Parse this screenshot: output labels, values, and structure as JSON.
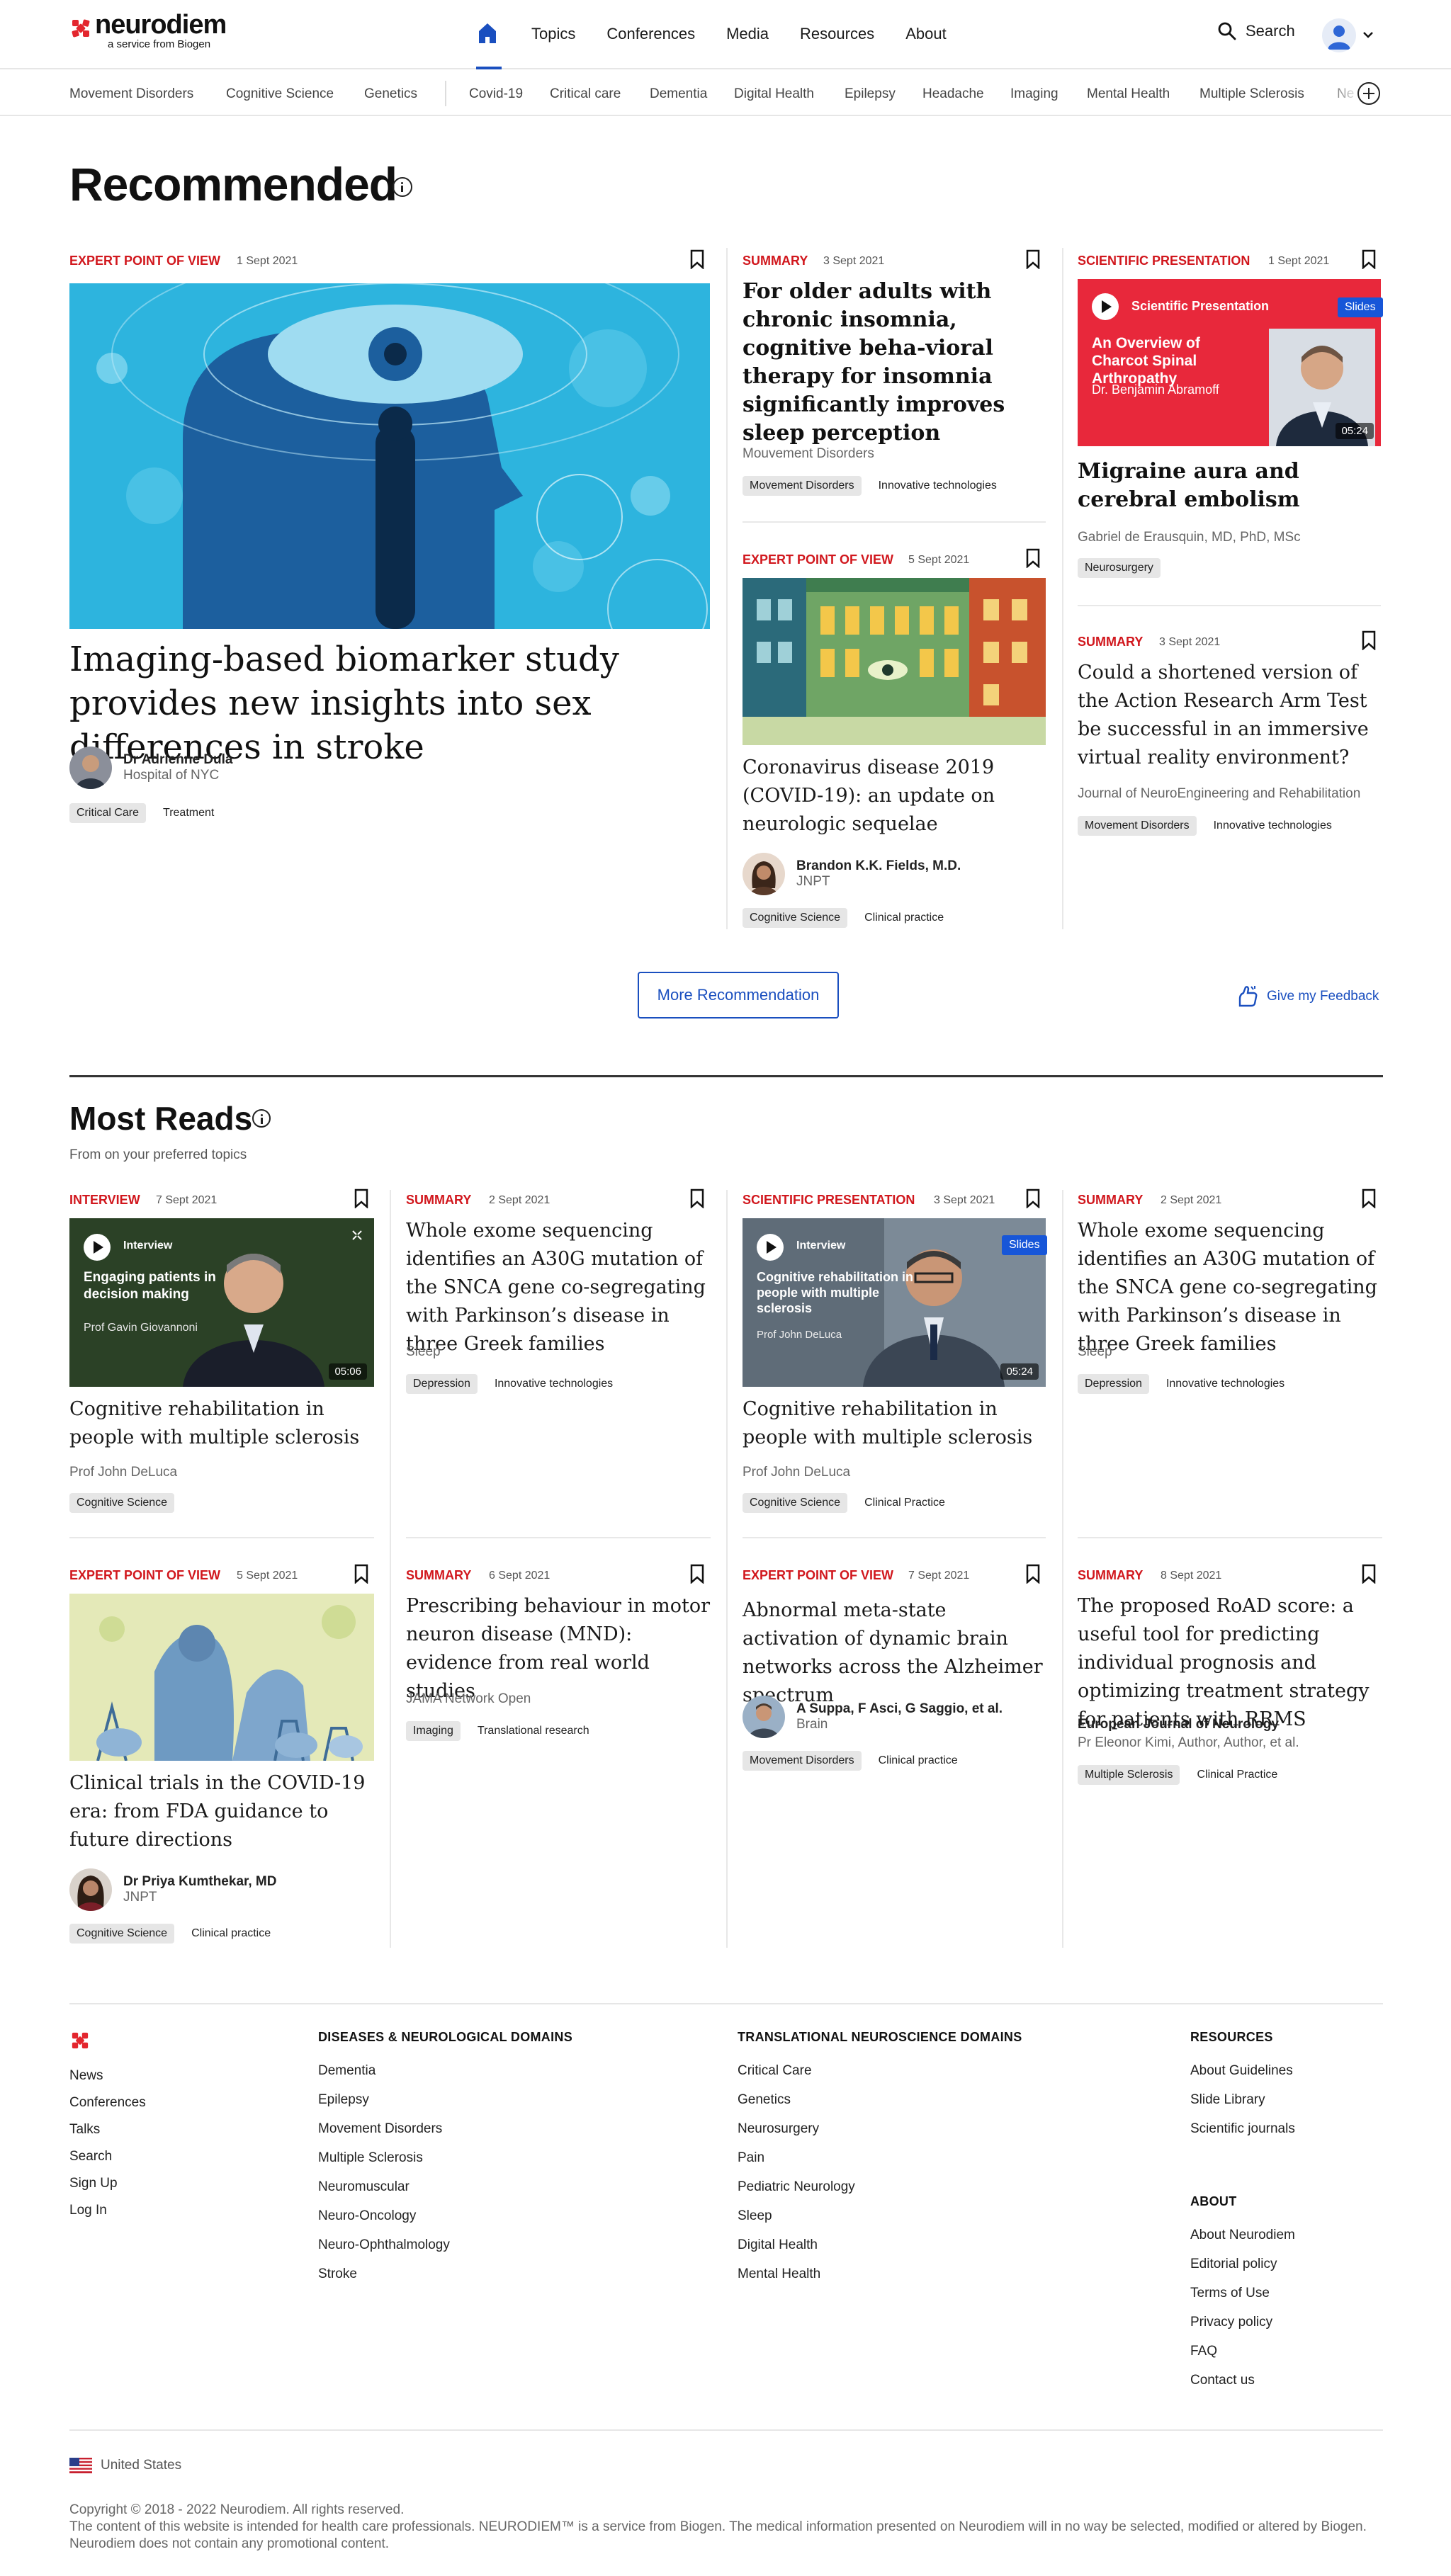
{
  "header": {
    "logo": "neurodiem",
    "logo_sub": "a service from Biogen",
    "nav": [
      "Topics",
      "Conferences",
      "Media",
      "Resources",
      "About"
    ],
    "search_label": "Search"
  },
  "topics": [
    "Movement Disorders",
    "Cognitive Science",
    "Genetics",
    "Covid-19",
    "Critical care",
    "Dementia",
    "Digital Health",
    "Epilepsy",
    "Headache",
    "Imaging",
    "Mental Health",
    "Multiple Sclerosis",
    "Ne"
  ],
  "recommended": {
    "title": "Recommended",
    "feature": {
      "kind": "Expert point of view",
      "date": "1 Sept 2021",
      "title": "Imaging-based biomarker study provides new insights into sex differences in stroke",
      "author": "Dr Adrienne Dula",
      "affiliation": "Hospital of NYC",
      "tags": [
        "Critical Care",
        "Treatment"
      ]
    },
    "c2": {
      "kind": "Summary",
      "date": "3 Sept 2021",
      "title": "For older adults with chronic insomnia, cognitive beha-vioral therapy for insomnia significantly improves sleep perception",
      "source": "Mouvement Disorders",
      "tags": [
        "Movement Disorders",
        "Innovative technologies"
      ]
    },
    "c3": {
      "kind": "Expert point of view",
      "date": "5 Sept 2021",
      "title": "Coronavirus disease 2019 (COVID-19): an update on neurologic sequelae",
      "author": "Brandon K.K. Fields, M.D.",
      "affiliation": "JNPT",
      "tags": [
        "Cognitive Science",
        "Clinical practice"
      ]
    },
    "c4": {
      "kind": "Scientific presentation",
      "date": "1 Sept 2021",
      "video_label": "Scientific Presentation",
      "video_title": "An Overview of Charcot Spinal Arthropathy",
      "video_speaker": "Dr. Benjamin Abramoff",
      "slides": "Slides",
      "duration": "05:24",
      "title": "Migraine aura and cerebral embolism",
      "source": "Gabriel de Erausquin, MD, PhD, MSc",
      "tags": [
        "Neurosurgery"
      ]
    },
    "c5": {
      "kind": "Summary",
      "date": "3 Sept 2021",
      "title": "Could a shortened version of the Action Research Arm Test be successful in an immersive virtual reality environment?",
      "source": "Journal of NeuroEngineering and Rehabilitation",
      "tags": [
        "Movement Disorders",
        "Innovative technologies"
      ]
    },
    "more_button": "More Recommendation",
    "feedback": "Give my Feedback"
  },
  "most_reads": {
    "title": "Most Reads",
    "subtitle": "From on your preferred topics",
    "r1": {
      "kind": "Interview",
      "date": "7 Sept 2021",
      "video_label": "Interview",
      "video_title": "Engaging patients in decision making",
      "video_speaker": "Prof Gavin Giovannoni",
      "duration": "05:06",
      "title": "Cognitive rehabilitation in people with multiple sclerosis",
      "source": "Prof John DeLuca",
      "tags": [
        "Cognitive Science"
      ]
    },
    "r2": {
      "kind": "Summary",
      "date": "2 Sept 2021",
      "title": "Whole exome sequencing identifies an A30G mutation of the SNCA gene co-segregating with Parkinson’s disease in three Greek families",
      "source": "Sleep",
      "tags": [
        "Depression",
        "Innovative technologies"
      ]
    },
    "r3": {
      "kind": "Scientific presentation",
      "date": "3 Sept 2021",
      "video_label": "Interview",
      "video_title": "Cognitive rehabilitation in people with multiple sclerosis",
      "video_speaker": "Prof John DeLuca",
      "slides": "Slides",
      "duration": "05:24",
      "title": "Cognitive rehabilitation in people with multiple sclerosis",
      "source": "Prof John DeLuca",
      "tags": [
        "Cognitive Science",
        "Clinical Practice"
      ]
    },
    "r4": {
      "kind": "Summary",
      "date": "2 Sept 2021",
      "title": "Whole exome sequencing identifies an A30G mutation of the SNCA gene co-segregating with Parkinson’s disease in three Greek families",
      "source": "Sleep",
      "tags": [
        "Depression",
        "Innovative technologies"
      ]
    },
    "r5": {
      "kind": "Expert point of view",
      "date": "5 Sept 2021",
      "title": "Clinical trials in the COVID-19 era: from FDA guidance to future directions",
      "author": "Dr Priya Kumthekar, MD",
      "affiliation": "JNPT",
      "tags": [
        "Cognitive Science",
        "Clinical practice"
      ]
    },
    "r6": {
      "kind": "Summary",
      "date": "6 Sept 2021",
      "title": "Prescribing behaviour in motor neuron disease (MND): evidence from real world studies",
      "source": "JAMA Network Open",
      "tags": [
        "Imaging",
        "Translational research"
      ]
    },
    "r7": {
      "kind": "Expert point of view",
      "date": "7 Sept 2021",
      "title": "Abnormal meta-state activation of dynamic brain networks across the Alzheimer spectrum",
      "author": "A Suppa, F Asci, G Saggio, et al.",
      "affiliation": "Brain",
      "tags": [
        "Movement Disorders",
        "Clinical practice"
      ]
    },
    "r8": {
      "kind": "Summary",
      "date": "8 Sept 2021",
      "title": "The proposed RoAD score: a useful tool for predicting individual prognosis and optimizing treatment strategy for patients with RRMS",
      "journal": "European Journal of Neurology",
      "source": "Pr Eleonor Kimi, Author, Author, et al.",
      "tags": [
        "Multiple Sclerosis",
        "Clinical Practice"
      ]
    }
  },
  "footer": {
    "main_links": [
      "News",
      "Conferences",
      "Talks",
      "Search",
      "Sign Up",
      "Log In"
    ],
    "diseases_title": "Diseases & Neurological Domains",
    "diseases": [
      "Dementia",
      "Epilepsy",
      "Movement Disorders",
      "Multiple Sclerosis",
      "Neuromuscular",
      "Neuro-Oncology",
      "Neuro-Ophthalmology",
      "Stroke"
    ],
    "translational_title": "Translational Neuroscience Domains",
    "translational": [
      "Critical Care",
      "Genetics",
      "Neurosurgery",
      "Pain",
      "Pediatric Neurology",
      "Sleep",
      "Digital Health",
      "Mental Health"
    ],
    "resources_title": "Resources",
    "resources": [
      "About Guidelines",
      "Slide Library",
      "Scientific journals"
    ],
    "about_title": "About",
    "about": [
      "About Neurodiem",
      "Editorial policy",
      "Terms of Use",
      "Privacy policy",
      "FAQ",
      "Contact us"
    ],
    "country": "United States",
    "copyright": "Copyright © 2018 - 2022 Neurodiem. All rights reserved.",
    "disclaimer": "The content of this website is intended for health care professionals. NEURODIEM™ is a service from Biogen. The medical information presented on Neurodiem will in no way be selected, modified or altered by Biogen. Neurodiem does not contain any promotional content."
  },
  "colors": {
    "accent": "#d1171d",
    "link": "#1a4fbf",
    "slides": "#1756d8",
    "video_red": "#e8283b"
  }
}
